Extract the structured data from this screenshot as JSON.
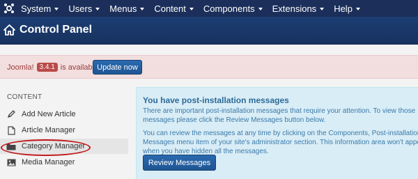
{
  "topbar": {
    "logo_icon": "joomla-logo-icon",
    "menu": [
      {
        "label": "System"
      },
      {
        "label": "Users"
      },
      {
        "label": "Menus"
      },
      {
        "label": "Content"
      },
      {
        "label": "Components"
      },
      {
        "label": "Extensions"
      },
      {
        "label": "Help"
      }
    ]
  },
  "header": {
    "icon": "home-icon",
    "title": "Control Panel"
  },
  "alert": {
    "prefix": "Joomla!",
    "version": "3.4.1",
    "suffix": "is available:",
    "button_label": "Update now"
  },
  "sidebar": {
    "heading": "CONTENT",
    "items": [
      {
        "label": "Add New Article",
        "icon": "pencil-icon"
      },
      {
        "label": "Article Manager",
        "icon": "document-icon"
      },
      {
        "label": "Category Manager",
        "icon": "folder-icon"
      },
      {
        "label": "Media Manager",
        "icon": "image-icon"
      }
    ]
  },
  "info": {
    "title": "You have post-installation messages",
    "paragraph1": "There are important post-installation messages that require your attention. To view those messages please click the Review Messages button below.",
    "paragraph2": "You can review the messages at any time by clicking on the Components, Post-installation Messages menu item of your site's administrator section. This information area won't appear when you have hidden all the messages.",
    "button_label": "Review Messages"
  },
  "colors": {
    "navbar": "#1b2f5a",
    "header": "#1c3e73",
    "alert_bg": "#f2dede",
    "info_bg": "#d9edf7",
    "button": "#2a6ab0",
    "annotation": "#c0171a"
  }
}
